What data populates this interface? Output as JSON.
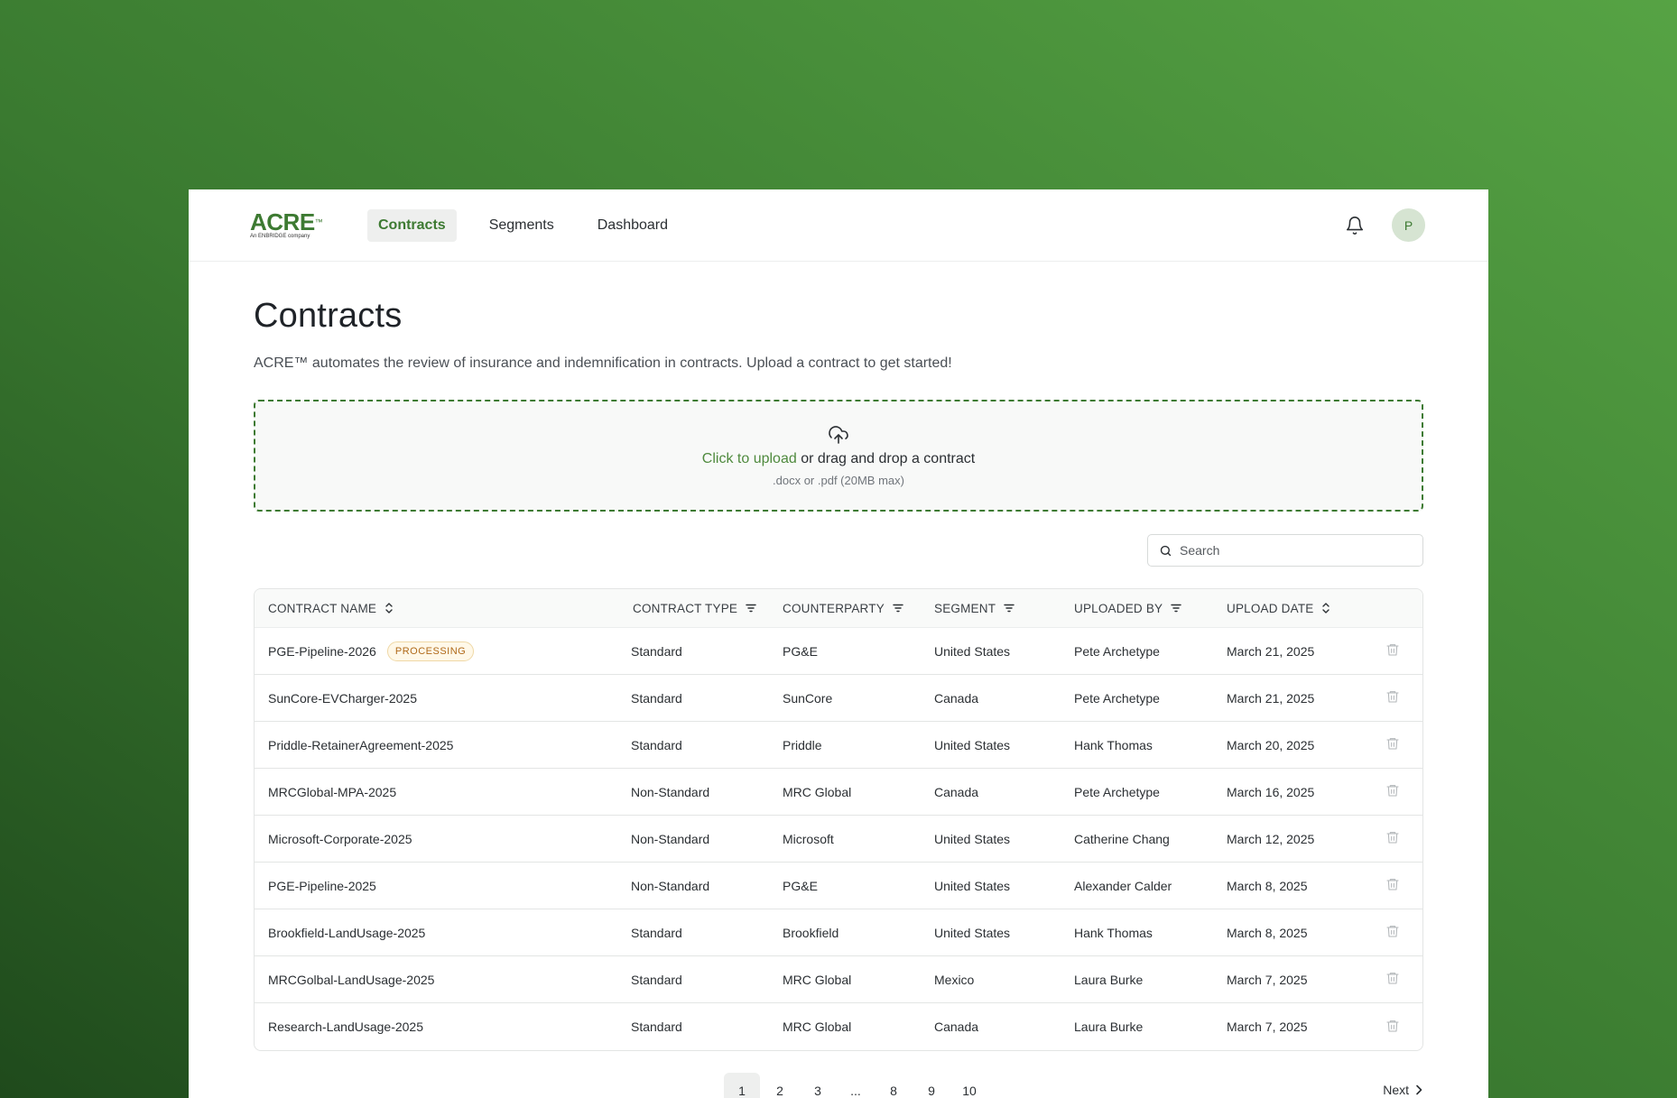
{
  "brand": {
    "logo_text": "ACRE",
    "logo_tm": "™",
    "logo_sub": "An ENBRIDGE company"
  },
  "nav": {
    "items": [
      {
        "label": "Contracts"
      },
      {
        "label": "Segments"
      },
      {
        "label": "Dashboard"
      }
    ],
    "active": "Contracts"
  },
  "user": {
    "avatar_initial": "P"
  },
  "page": {
    "title": "Contracts",
    "subtitle": "ACRE™ automates the review of insurance and indemnification in contracts. Upload a contract to get started!"
  },
  "upload": {
    "link_text": "Click to upload",
    "rest_text": " or drag and drop a contract",
    "hint": ".docx or .pdf (20MB max)"
  },
  "search": {
    "placeholder": "Search"
  },
  "table": {
    "headers": [
      "CONTRACT NAME",
      "CONTRACT TYPE",
      "COUNTERPARTY",
      "SEGMENT",
      "UPLOADED BY",
      "UPLOAD DATE"
    ],
    "rows": [
      {
        "name": "PGE-Pipeline-2026",
        "badge": "PROCESSING",
        "type": "Standard",
        "counterparty": "PG&E",
        "segment": "United States",
        "uploaded_by": "Pete Archetype",
        "date": "March 21, 2025"
      },
      {
        "name": "SunCore-EVCharger-2025",
        "badge": "",
        "type": "Standard",
        "counterparty": "SunCore",
        "segment": "Canada",
        "uploaded_by": "Pete Archetype",
        "date": "March 21, 2025"
      },
      {
        "name": "Priddle-RetainerAgreement-2025",
        "badge": "",
        "type": "Standard",
        "counterparty": "Priddle",
        "segment": "United States",
        "uploaded_by": "Hank Thomas",
        "date": "March 20, 2025"
      },
      {
        "name": "MRCGlobal-MPA-2025",
        "badge": "",
        "type": "Non-Standard",
        "counterparty": "MRC Global",
        "segment": "Canada",
        "uploaded_by": "Pete Archetype",
        "date": "March 16, 2025"
      },
      {
        "name": "Microsoft-Corporate-2025",
        "badge": "",
        "type": "Non-Standard",
        "counterparty": "Microsoft",
        "segment": "United States",
        "uploaded_by": "Catherine Chang",
        "date": "March 12, 2025"
      },
      {
        "name": "PGE-Pipeline-2025",
        "badge": "",
        "type": "Non-Standard",
        "counterparty": "PG&E",
        "segment": "United States",
        "uploaded_by": "Alexander Calder",
        "date": "March 8, 2025"
      },
      {
        "name": "Brookfield-LandUsage-2025",
        "badge": "",
        "type": "Standard",
        "counterparty": "Brookfield",
        "segment": "United States",
        "uploaded_by": "Hank Thomas",
        "date": "March 8, 2025"
      },
      {
        "name": "MRCGolbal-LandUsage-2025",
        "badge": "",
        "type": "Standard",
        "counterparty": "MRC Global",
        "segment": "Mexico",
        "uploaded_by": "Laura Burke",
        "date": "March 7, 2025"
      },
      {
        "name": "Research-LandUsage-2025",
        "badge": "",
        "type": "Standard",
        "counterparty": "MRC Global",
        "segment": "Canada",
        "uploaded_by": "Laura Burke",
        "date": "March 7, 2025"
      }
    ]
  },
  "pagination": {
    "pages": [
      "1",
      "2",
      "3",
      "...",
      "8",
      "9",
      "10"
    ],
    "current": "1",
    "next_label": "Next"
  },
  "colors": {
    "accent": "#3d7a32",
    "badge_text": "#b06a1a"
  }
}
